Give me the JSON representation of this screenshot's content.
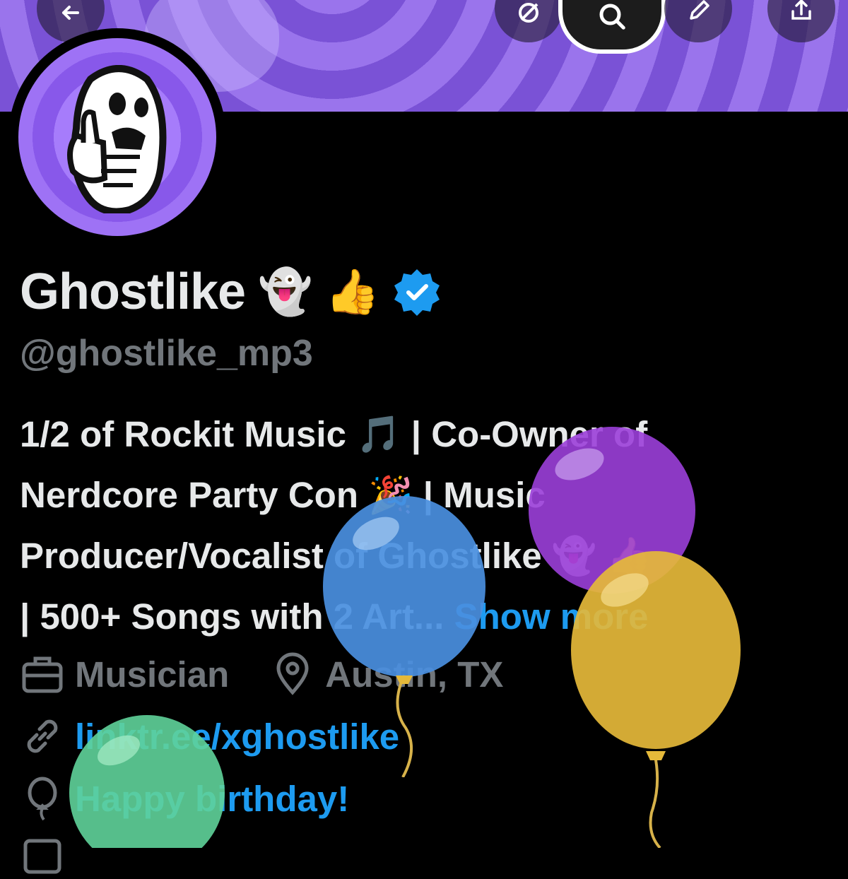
{
  "profile": {
    "name": "Ghostlike",
    "name_emojis": [
      "👻",
      "👍"
    ],
    "verified": true,
    "handle": "@ghostlike_mp3",
    "bio_lines": [
      "1/2 of Rockit Music 🎵 | Co-Owner of",
      "Nerdcore Party Con 🎉 | Music",
      "Producer/Vocalist of Ghostlike 👻 👍",
      "| 500+ Songs with 2 Art...  "
    ],
    "show_more": "Show more",
    "profession": "Musician",
    "location": "Austin, TX",
    "link": "linktr.ee/xghostlike",
    "birthday": "Happy birthday!"
  },
  "icons": {
    "back": "arrow-left-icon",
    "grok": "grok-icon",
    "search": "search-icon",
    "edit": "pencil-icon",
    "share": "share-icon",
    "work": "briefcase-icon",
    "location": "location-pin-icon",
    "link": "link-icon",
    "birthday": "balloon-icon",
    "verified": "verified-badge-icon"
  },
  "colors": {
    "background": "#000000",
    "text_primary": "#e7e9ea",
    "text_secondary": "#71767b",
    "accent": "#1d9bf0",
    "banner_light": "#9a74ec",
    "banner_dark": "#7a52d6",
    "balloon_blue": "#4a90e2",
    "balloon_purple": "#9b3fd9",
    "balloon_gold": "#e5b93a",
    "balloon_green": "#5fd39a"
  }
}
